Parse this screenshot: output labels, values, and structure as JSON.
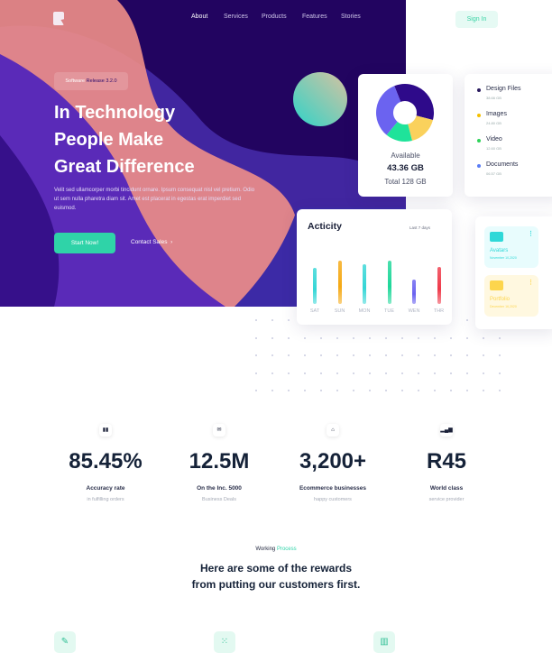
{
  "nav": {
    "links": [
      "About",
      "Services",
      "Products",
      "Features",
      "Stories"
    ],
    "sign_in": "Sign In"
  },
  "hero": {
    "badge_prefix": "Software",
    "badge_release": "Release 3.2.0",
    "title_lines": [
      "In Technology",
      "People Make",
      "Great Difference"
    ],
    "description": "Velit sed ullamcorper morbi tincidunt ornare. Ipsum consequat nisl vel pretium. Odio ut sem nulla pharetra diam sit. Amet est placerat in egestas erat imperdiet sed euismod.",
    "start_button": "Start Now!",
    "contact_link": "Contact Sales",
    "contact_arrow": "›"
  },
  "storage": {
    "available_label": "Available",
    "available_value": "43.36 GB",
    "total": "Total 128 GB",
    "segments": [
      {
        "name": "Design Files",
        "size": "38.66 GB",
        "color": "#2e0a8a",
        "share": 35
      },
      {
        "name": "Images",
        "size": "24.80 GB",
        "color": "#fad15c",
        "share": 17
      },
      {
        "name": "Video",
        "size": "12.60 GB",
        "color": "#1fe39a",
        "share": 15
      },
      {
        "name": "Documents",
        "size": "06.57 GB",
        "color": "#6b63f0",
        "share": 33
      }
    ],
    "legend_dot_colors": [
      "#2a1a5e",
      "#f5c000",
      "#2fd35a",
      "#5a7cf5"
    ]
  },
  "activity": {
    "title": "Acticity",
    "range": "Last 7 days",
    "days": [
      {
        "label": "SAT",
        "value": 40,
        "color": "#35d6d6"
      },
      {
        "label": "SUN",
        "value": 48,
        "color": "#f5a914"
      },
      {
        "label": "MON",
        "value": 44,
        "color": "#35d6d6"
      },
      {
        "label": "TUE",
        "value": 48,
        "color": "#1fd79a"
      },
      {
        "label": "WEN",
        "value": 27,
        "color": "#6b63f0"
      },
      {
        "label": "THR",
        "value": 41,
        "color": "#ef3a4a"
      }
    ]
  },
  "folders": [
    {
      "name": "Avatars",
      "date": "November 10,2020",
      "color": "#2fd8d8",
      "bg": "#e8fcfd"
    },
    {
      "name": "Portfolio",
      "date": "December 16,2020",
      "color": "#fdd54d",
      "bg": "#fff8e0"
    }
  ],
  "stats": [
    {
      "icon": "bar-chart-icon",
      "glyph": "▮▮",
      "value": "85.45%",
      "label": "Accuracy rate",
      "sub": "in fulfilling orders"
    },
    {
      "icon": "message-icon",
      "glyph": "✉",
      "value": "12.5M",
      "label": "On the Inc. 5000",
      "sub": "Business Deals"
    },
    {
      "icon": "basket-icon",
      "glyph": "⌂",
      "value": "3,200+",
      "label": "Ecommerce businesses",
      "sub": "happy customers"
    },
    {
      "icon": "signal-icon",
      "glyph": "▂▄▆",
      "value": "R45",
      "label": "World class",
      "sub": "service provider"
    }
  ],
  "process": {
    "prefix": "Working",
    "highlight": "Process",
    "heading_lines": [
      "Here are some of the rewards",
      "from putting our customers first."
    ]
  },
  "bottom_icons": [
    {
      "icon": "pencil-icon",
      "glyph": "✎"
    },
    {
      "icon": "grid-icon",
      "glyph": "⁙"
    },
    {
      "icon": "chart-icon",
      "glyph": "▥"
    }
  ]
}
